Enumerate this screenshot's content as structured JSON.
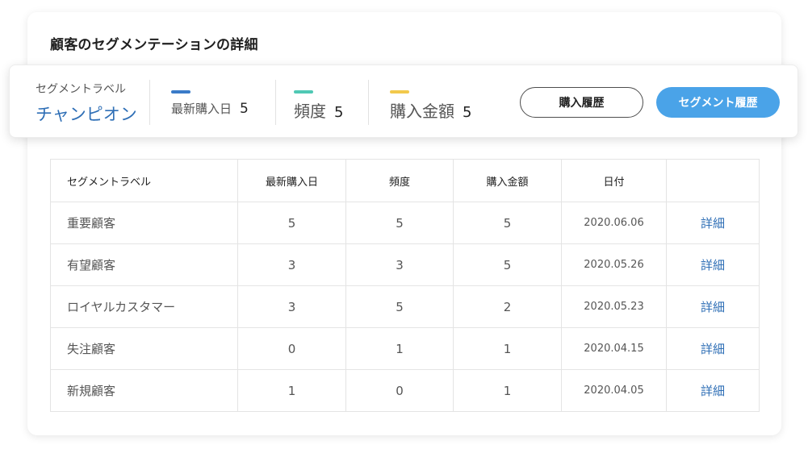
{
  "card": {
    "title": "顧客のセグメンテーションの詳細"
  },
  "summary": {
    "segment_label_caption": "セグメントラベル",
    "segment_value": "チャンピオン",
    "metrics": [
      {
        "label": "最新購入日",
        "value": "5",
        "color": "#3a7bc8"
      },
      {
        "label": "頻度",
        "value": "5",
        "color": "#4fc8b4"
      },
      {
        "label": "購入金額",
        "value": "5",
        "color": "#f2c94c"
      }
    ],
    "buttons": {
      "purchase_history": "購入履歴",
      "segment_history": "セグメント履歴"
    }
  },
  "table": {
    "headers": [
      "セグメントラベル",
      "最新購入日",
      "頻度",
      "購入金額",
      "日付",
      ""
    ],
    "rows": [
      {
        "label": "重要顧客",
        "recency": "5",
        "frequency": "5",
        "monetary": "5",
        "date": "2020.06.06",
        "action": "詳細"
      },
      {
        "label": "有望顧客",
        "recency": "3",
        "frequency": "3",
        "monetary": "5",
        "date": "2020.05.26",
        "action": "詳細"
      },
      {
        "label": "ロイヤルカスタマー",
        "recency": "3",
        "frequency": "5",
        "monetary": "2",
        "date": "2020.05.23",
        "action": "詳細"
      },
      {
        "label": "失注顧客",
        "recency": "0",
        "frequency": "1",
        "monetary": "1",
        "date": "2020.04.15",
        "action": "詳細"
      },
      {
        "label": "新規顧客",
        "recency": "1",
        "frequency": "0",
        "monetary": "1",
        "date": "2020.04.05",
        "action": "詳細"
      }
    ]
  },
  "colors": {
    "accent_blue": "#2f6fb6",
    "button_blue": "#4aa3e8"
  }
}
